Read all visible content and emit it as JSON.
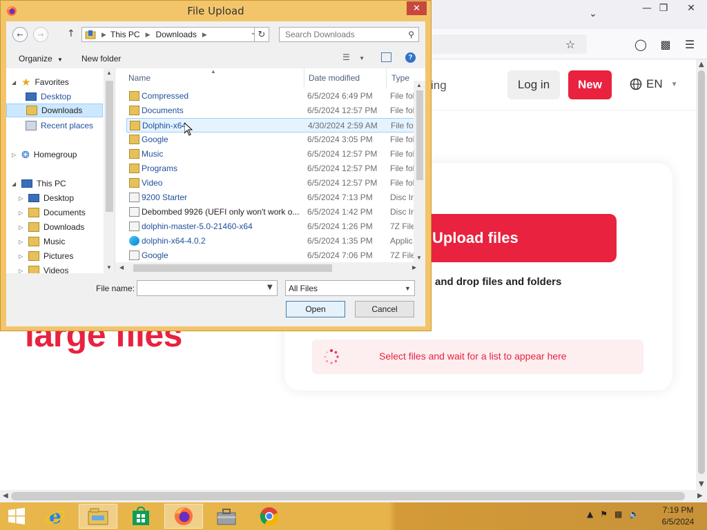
{
  "browser": {
    "nav_partial": "ing",
    "login_label": "Log in",
    "new_label": "New",
    "lang_label": "EN",
    "upload_button_label": "Upload files",
    "drag_drop_text": "and drop files and folders",
    "files_hint_text": "Select files and wait for a list to appear here",
    "hero_text": "large files",
    "colors": {
      "accent": "#e8223f",
      "hint_bg": "#fdeef0"
    }
  },
  "dialog": {
    "title": "File Upload",
    "breadcrumb": [
      "This PC",
      "Downloads"
    ],
    "search_placeholder": "Search Downloads",
    "organize_label": "Organize",
    "new_folder_label": "New folder",
    "tree": [
      {
        "label": "Favorites",
        "icon": "star-icon",
        "level": 0,
        "expanded": true
      },
      {
        "label": "Desktop",
        "icon": "desktop-icon",
        "level": 1
      },
      {
        "label": "Downloads",
        "icon": "downloads-icon",
        "level": 1,
        "selected": true
      },
      {
        "label": "Recent places",
        "icon": "recent-places-icon",
        "level": 1
      },
      {
        "label": "Homegroup",
        "icon": "homegroup-icon",
        "level": 0
      },
      {
        "label": "This PC",
        "icon": "computer-icon",
        "level": 0,
        "expanded": true
      },
      {
        "label": "Desktop",
        "icon": "desktop-icon",
        "level": 1
      },
      {
        "label": "Documents",
        "icon": "documents-icon",
        "level": 1
      },
      {
        "label": "Downloads",
        "icon": "downloads-icon",
        "level": 1
      },
      {
        "label": "Music",
        "icon": "music-icon",
        "level": 1
      },
      {
        "label": "Pictures",
        "icon": "pictures-icon",
        "level": 1
      },
      {
        "label": "Videos",
        "icon": "videos-icon",
        "level": 1
      }
    ],
    "columns": {
      "name": "Name",
      "date": "Date modified",
      "type": "Type"
    },
    "files": [
      {
        "name": "Compressed",
        "date": "6/5/2024 6:49 PM",
        "type": "File fol",
        "icon": "folder-icon"
      },
      {
        "name": "Documents",
        "date": "6/5/2024 12:57 PM",
        "type": "File fol",
        "icon": "folder-icon"
      },
      {
        "name": "Dolphin-x64",
        "date": "4/30/2024 2:59 AM",
        "type": "File fol",
        "icon": "folder-icon",
        "selected": true
      },
      {
        "name": "Google",
        "date": "6/5/2024 3:05 PM",
        "type": "File fol",
        "icon": "folder-icon"
      },
      {
        "name": "Music",
        "date": "6/5/2024 12:57 PM",
        "type": "File fol",
        "icon": "folder-icon"
      },
      {
        "name": "Programs",
        "date": "6/5/2024 12:57 PM",
        "type": "File fol",
        "icon": "folder-icon"
      },
      {
        "name": "Video",
        "date": "6/5/2024 12:57 PM",
        "type": "File fol",
        "icon": "folder-icon"
      },
      {
        "name": "9200 Starter",
        "date": "6/5/2024 7:13 PM",
        "type": "Disc In",
        "icon": "disc-image-icon"
      },
      {
        "name": "Debombed 9926 (UEFI only won't work o...",
        "date": "6/5/2024 1:42 PM",
        "type": "Disc In",
        "icon": "disc-image-icon",
        "dark": true
      },
      {
        "name": "dolphin-master-5.0-21460-x64",
        "date": "6/5/2024 1:26 PM",
        "type": "7Z File",
        "icon": "archive-file-icon"
      },
      {
        "name": "dolphin-x64-4.0.2",
        "date": "6/5/2024 1:35 PM",
        "type": "Applic",
        "icon": "application-icon"
      },
      {
        "name": "Google",
        "date": "6/5/2024 7:06 PM",
        "type": "7Z File",
        "icon": "archive-file-icon"
      }
    ],
    "file_name_label": "File name:",
    "file_name_value": "",
    "file_type_value": "All Files",
    "open_label": "Open",
    "cancel_label": "Cancel"
  },
  "taskbar": {
    "apps": [
      "start-icon",
      "ie-icon",
      "file-explorer-icon",
      "store-icon",
      "firefox-icon",
      "briefcase-icon",
      "chrome-icon"
    ],
    "time": "7:19 PM",
    "date": "6/5/2024"
  }
}
